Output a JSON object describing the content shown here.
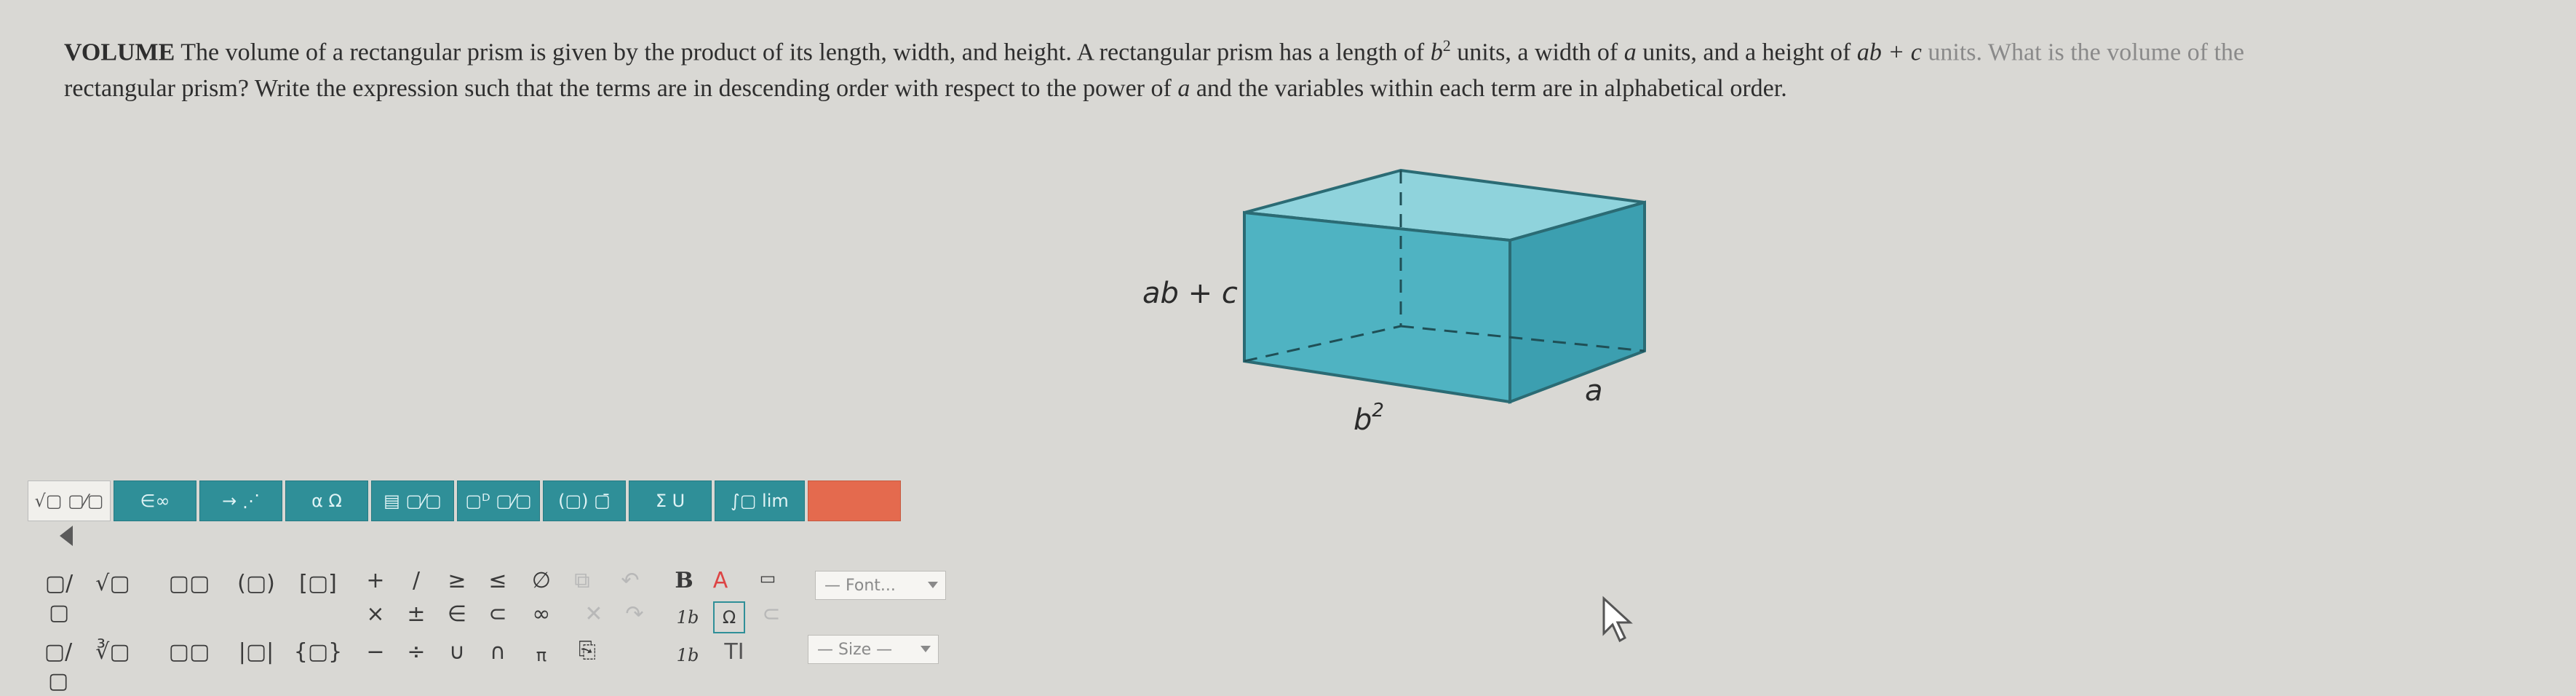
{
  "question": {
    "lead": "VOLUME",
    "text_1": " The volume of a rectangular prism is given by the product of its length, width, and height. A rectangular prism has a length of ",
    "len_var": "b",
    "len_exp": "2",
    "text_2": " units, a width of ",
    "width_var": "a",
    "text_3": " units, and a height of ",
    "height_expr": "ab + c",
    "text_4": " units. What is the volume of the",
    "text_5": "rectangular prism? Write the expression such that the terms are in descending order with respect to the power of ",
    "power_var": "a",
    "text_6": " and the variables within each term are in alphabetical order."
  },
  "figure": {
    "height_label": "ab + c",
    "length_label": "b",
    "length_exp": "2",
    "width_label": "a",
    "fill_front": "#4fb3c2",
    "fill_top": "#8fd3dc",
    "fill_side": "#3c9fb0"
  },
  "tabs": [
    {
      "label": "√▢ ▢⁄▢",
      "id": "radicals"
    },
    {
      "label": "∈∞",
      "id": "sets"
    },
    {
      "label": "→ ⋰",
      "id": "arrows"
    },
    {
      "label": "α Ω",
      "id": "greek"
    },
    {
      "label": "▤ ▢⁄▢",
      "id": "matrix"
    },
    {
      "label": "▢ᴰ ▢⁄▢",
      "id": "scripts"
    },
    {
      "label": "(▢) ▢̄",
      "id": "brackets"
    },
    {
      "label": "Σ U",
      "id": "sums"
    },
    {
      "label": "∫▢ lim",
      "id": "calculus"
    },
    {
      "label": "",
      "id": "extra"
    }
  ],
  "palette": {
    "row1": [
      "▢/▢",
      "√▢",
      "▢▢",
      "(▢)",
      "[▢]",
      "+",
      "/",
      "≥",
      "≤",
      "∅"
    ],
    "row2": [
      "×",
      "±",
      "∈",
      "⊂",
      "∞"
    ],
    "row3": [
      "▢/▢",
      "∛▢",
      "▢▢",
      "|▢|",
      "{▢}",
      "−",
      "÷",
      "∪",
      "∩",
      "π"
    ],
    "bold": "B",
    "font_size_a": "1b",
    "font_size_b": "1b",
    "text_tool": "TI",
    "font_dropdown": "— Font...",
    "size_dropdown": "— Size —"
  }
}
